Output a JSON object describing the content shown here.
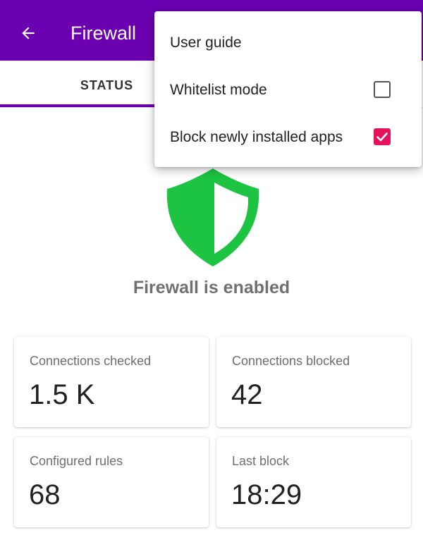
{
  "app_bar": {
    "title": "Firewall",
    "back_icon": "arrow-left-icon",
    "background": "#6a00b0"
  },
  "tabs": [
    {
      "label": "STATUS",
      "selected": true
    }
  ],
  "status": {
    "icon": "shield-icon",
    "text": "Firewall is enabled",
    "icon_color": "#1dc442"
  },
  "stats": [
    {
      "label": "Connections checked",
      "value": "1.5 K"
    },
    {
      "label": "Connections blocked",
      "value": "42"
    },
    {
      "label": "Configured rules",
      "value": "68"
    },
    {
      "label": "Last block",
      "value": "18:29"
    }
  ],
  "menu": {
    "items": [
      {
        "label": "User guide"
      },
      {
        "label": "Whitelist mode",
        "checked": false
      },
      {
        "label": "Block newly installed apps",
        "checked": true
      }
    ],
    "checkbox_color": "#e6135c"
  }
}
